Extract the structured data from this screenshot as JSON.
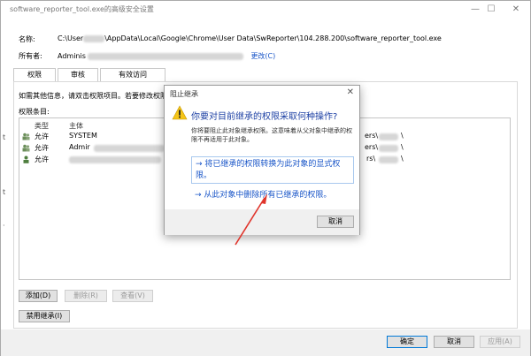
{
  "window": {
    "title": "software_reporter_tool.exe的高级安全设置",
    "controls": {
      "minimize": "—",
      "maximize": "☐",
      "close": "✕"
    }
  },
  "info": {
    "name_label": "名称:",
    "name_value": "C:\\Users\\██\\AppData\\Local\\Google\\Chrome\\User Data\\SwReporter\\104.288.200\\software_reporter_tool.exe",
    "name_prefix": "C:\\User",
    "name_suffix": "\\AppData\\Local\\Google\\Chrome\\User Data\\SwReporter\\104.288.200\\software_reporter_tool.exe",
    "owner_label": "所有者:",
    "owner_value": "Adminis",
    "owner_change": "更改(C)"
  },
  "tabs": [
    {
      "label": "权限"
    },
    {
      "label": "审核"
    },
    {
      "label": "有效访问"
    }
  ],
  "panel": {
    "hint": "如需其他信息，请双击权限项目。若要修改权限",
    "list_label": "权限条目:",
    "columns": {
      "type": "类型",
      "principal": "主体"
    },
    "rows": [
      {
        "type": "允许",
        "principal": "SYSTEM",
        "tail": "ers\\",
        "tail_end": "\\"
      },
      {
        "type": "允许",
        "principal": "Admir",
        "tail": "ers\\",
        "tail_end": "\\"
      },
      {
        "type": "允许",
        "principal": "",
        "tail": "rs\\",
        "tail_end": "\\"
      }
    ]
  },
  "buttons": {
    "add": "添加(D)",
    "remove": "删除(R)",
    "view": "查看(V)",
    "disable_inherit": "禁用继承(I)",
    "ok": "确定",
    "cancel": "取消",
    "apply": "应用(A)"
  },
  "modal": {
    "title": "阻止继承",
    "close": "✕",
    "heading": "你要对目前继承的权限采取何种操作?",
    "description": "你将要阻止此对象继承权限。这意味着从父对象中继承的权限不再适用于此对象。",
    "option1": "→ 将已继承的权限转换为此对象的显式权限。",
    "option2": "→ 从此对象中删除所有已继承的权限。",
    "cancel": "取消"
  },
  "colors": {
    "accent": "#0078d7",
    "link": "#1a56c8",
    "heading": "#1b3fa3",
    "annotation_arrow": "#e0342b",
    "warning_yellow": "#f5c518"
  }
}
